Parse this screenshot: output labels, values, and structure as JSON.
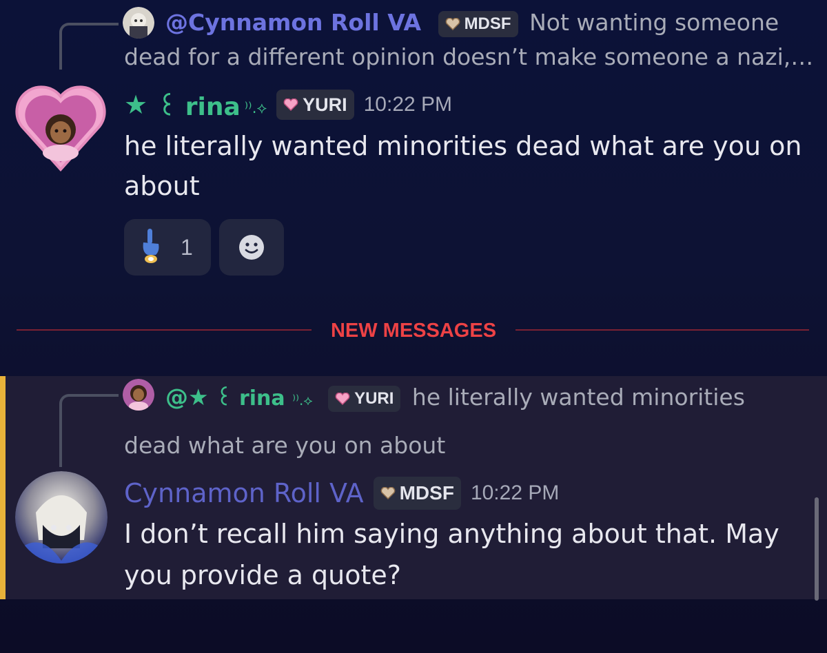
{
  "colors": {
    "accent_green": "#3dbf8a",
    "accent_purple": "#5e63c9",
    "new_messages_red": "#ed4245",
    "highlight_bar": "#e8b23a"
  },
  "message1": {
    "reply": {
      "author": "@Cynnamon Roll VA",
      "badge": "MDSF",
      "preview_line1": "Not wanting someone",
      "preview_line2": "dead for a different opinion doesn’t make someone a nazi,…"
    },
    "author": {
      "star": "★",
      "name": "꒰ rina",
      "suffix": "⁾⁾.⟡"
    },
    "badge": "YURI",
    "timestamp": "10:22 PM",
    "text_line1": "he literally wanted minorities dead what are you on",
    "text_line2": "about",
    "reactions": [
      {
        "icon": "pointing-finger-emoji",
        "count": "1"
      },
      {
        "icon": "add-reaction-icon",
        "count": ""
      }
    ]
  },
  "divider": {
    "label": "NEW MESSAGES"
  },
  "message2": {
    "reply": {
      "author_prefix": "@★",
      "author": "꒰ rina",
      "suffix": "⁾⁾.⟡",
      "badge": "YURI",
      "preview_line1": "he literally wanted minorities",
      "preview_line2": "dead what are you on about"
    },
    "author": "Cynnamon Roll VA",
    "badge": "MDSF",
    "timestamp": "10:22 PM",
    "text_line1": "I don’t recall him saying anything about that. May",
    "text_line2": "you provide a quote?"
  }
}
